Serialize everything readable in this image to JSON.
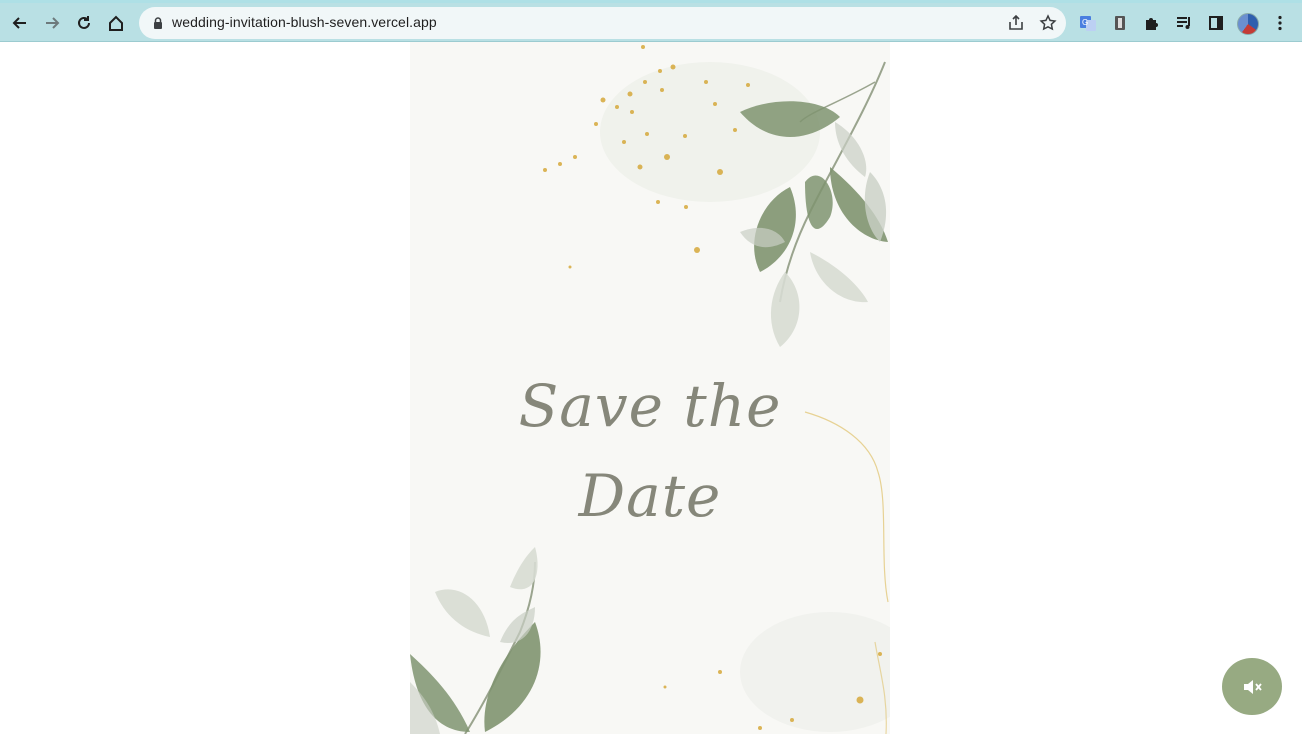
{
  "browser": {
    "url": "wedding-invitation-blush-seven.vercel.app",
    "icons": [
      "back-icon",
      "forward-icon",
      "reload-icon",
      "home-icon",
      "lock-icon",
      "share-icon",
      "star-icon",
      "translate-icon",
      "extension-icon",
      "puzzle-icon",
      "media-icon",
      "sidepanel-icon",
      "profile-avatar",
      "menu-icon"
    ]
  },
  "card": {
    "title_line1": "Save the",
    "title_line2": "Date"
  },
  "audio": {
    "icon": "speaker-muted-icon"
  },
  "colors": {
    "toolbar": "#b9e0e4",
    "card_bg": "#f8f8f5",
    "title": "#86877a",
    "leaf": "#7f9470",
    "gold": "#d6a93b",
    "mute_button": "#97aa82"
  }
}
